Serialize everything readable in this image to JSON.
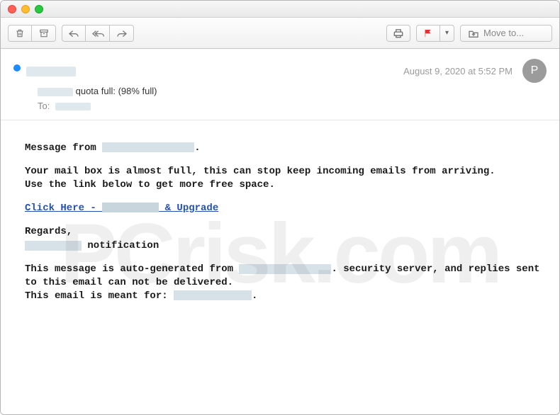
{
  "toolbar": {
    "move_label": "Move to..."
  },
  "header": {
    "date": "August 9, 2020 at 5:52 PM",
    "avatar_initial": "P",
    "subject_prefix": "",
    "subject_suffix": " quota full: (98% full)",
    "to_label": "To:"
  },
  "body": {
    "line1_a": "Message from ",
    "line1_b": ".",
    "line2": "Your mail box is almost full, this can stop keep incoming emails from arriving.\nUse the link below to get more free space.",
    "link_a": "Click Here - ",
    "link_b": " & Upgrade",
    "line4": "Regards,",
    "line5": " notification",
    "line6_a": "This message is auto-generated from ",
    "line6_b": ". security server, and replies sent to this email can not be delivered.\nThis email is meant for: ",
    "line6_c": "."
  },
  "watermark": "PCrisk.com"
}
